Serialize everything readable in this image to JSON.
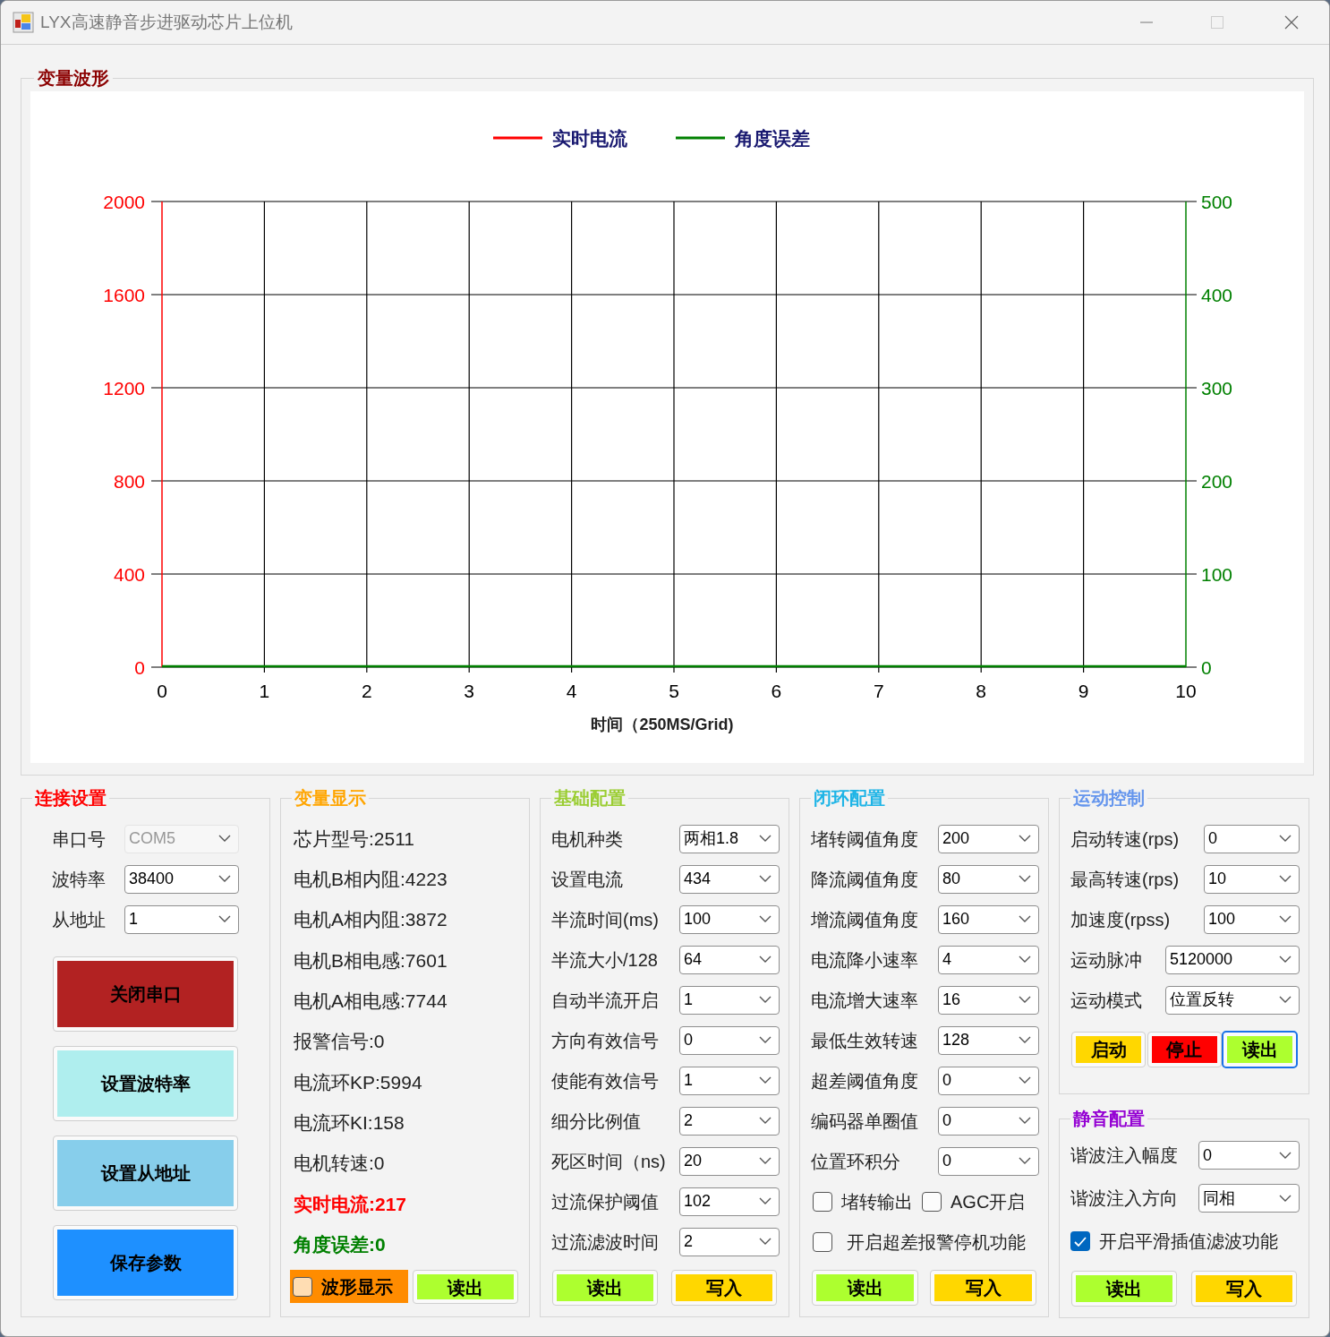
{
  "window": {
    "title": "LYX高速静音步进驱动芯片上位机"
  },
  "waveform": {
    "title": "变量波形",
    "chart_data": {
      "type": "line",
      "xlabel": "时间（250MS/Grid)",
      "grid": true,
      "categories": [
        "0",
        "1",
        "2",
        "3",
        "4",
        "5",
        "6",
        "7",
        "8",
        "9",
        "10"
      ],
      "ylim": [
        0,
        2000
      ],
      "yticks": [
        0,
        400,
        800,
        1200,
        1600,
        2000
      ],
      "y2lim": [
        0,
        500
      ],
      "y2ticks": [
        0,
        100,
        200,
        300,
        400,
        500
      ],
      "series": [
        {
          "name": "实时电流",
          "color": "#ff0000",
          "values": [
            null,
            null,
            null,
            null,
            null,
            null,
            null,
            null,
            null,
            null,
            null
          ]
        },
        {
          "name": "角度误差",
          "color": "#008000",
          "values": [
            0,
            0,
            0,
            0,
            0,
            0,
            0,
            0,
            0,
            0,
            0
          ]
        }
      ]
    }
  },
  "connection": {
    "title": "连接设置",
    "fields": [
      {
        "label": "串口号",
        "value": "COM5",
        "disabled": true
      },
      {
        "label": "波特率",
        "value": "38400",
        "disabled": false
      },
      {
        "label": "从地址",
        "value": "1",
        "disabled": false
      }
    ],
    "buttons": [
      {
        "label": "关闭串口",
        "color": "#b22222"
      },
      {
        "label": "设置波特率",
        "color": "#afeeee"
      },
      {
        "label": "设置从地址",
        "color": "#87ceeb"
      },
      {
        "label": "保存参数",
        "color": "#1e90ff"
      }
    ]
  },
  "variables": {
    "title": "变量显示",
    "items": [
      {
        "text": "芯片型号:2511",
        "kind": "plain"
      },
      {
        "text": "电机B相内阻:4223",
        "kind": "plain"
      },
      {
        "text": "电机A相内阻:3872",
        "kind": "plain"
      },
      {
        "text": "电机B相电感:7601",
        "kind": "plain"
      },
      {
        "text": "电机A相电感:7744",
        "kind": "plain"
      },
      {
        "text": "报警信号:0",
        "kind": "plain"
      },
      {
        "text": "电流环KP:5994",
        "kind": "plain"
      },
      {
        "text": "电流环KI:158",
        "kind": "plain"
      },
      {
        "text": "电机转速:0",
        "kind": "plain"
      },
      {
        "text": "实时电流:217",
        "kind": "current"
      },
      {
        "text": "角度误差:0",
        "kind": "angle"
      }
    ],
    "waveform_toggle": {
      "label": "波形显示",
      "checked": false
    },
    "read_button": "读出"
  },
  "basic": {
    "title": "基础配置",
    "fields": [
      {
        "label": "电机种类",
        "value": "两相1.8"
      },
      {
        "label": "设置电流",
        "value": "434"
      },
      {
        "label": "半流时间(ms)",
        "value": "100"
      },
      {
        "label": "半流大小/128",
        "value": "64"
      },
      {
        "label": "自动半流开启",
        "value": "1"
      },
      {
        "label": "方向有效信号",
        "value": "0"
      },
      {
        "label": "使能有效信号",
        "value": "1"
      },
      {
        "label": "细分比例值",
        "value": "2"
      },
      {
        "label": "死区时间（ns)",
        "value": "20"
      },
      {
        "label": "过流保护阈值",
        "value": "102"
      },
      {
        "label": "过流滤波时间",
        "value": "2"
      }
    ],
    "buttons": [
      {
        "label": "读出",
        "color": "#adff2f"
      },
      {
        "label": "写入",
        "color": "#ffd700"
      }
    ]
  },
  "closed_loop": {
    "title": "闭环配置",
    "fields": [
      {
        "label": "堵转阈值角度",
        "value": "200"
      },
      {
        "label": "降流阈值角度",
        "value": "80"
      },
      {
        "label": "增流阈值角度",
        "value": "160"
      },
      {
        "label": "电流降小速率",
        "value": "4"
      },
      {
        "label": "电流增大速率",
        "value": "16"
      },
      {
        "label": "最低生效转速",
        "value": "128"
      },
      {
        "label": "超差阈值角度",
        "value": "0"
      },
      {
        "label": "编码器单圈值",
        "value": "0"
      },
      {
        "label": "位置环积分",
        "value": "0"
      }
    ],
    "checkboxes": [
      {
        "label": "堵转输出",
        "checked": false
      },
      {
        "label": "AGC开启",
        "checked": false
      },
      {
        "label": "开启超差报警停机功能",
        "checked": false
      }
    ],
    "buttons": [
      {
        "label": "读出",
        "color": "#adff2f"
      },
      {
        "label": "写入",
        "color": "#ffd700"
      }
    ]
  },
  "motion": {
    "title": "运动控制",
    "fields": [
      {
        "label": "启动转速(rps)",
        "value": "0",
        "kind": "narrow"
      },
      {
        "label": "最高转速(rps)",
        "value": "10",
        "kind": "narrow"
      },
      {
        "label": "加速度(rpss)",
        "value": "100",
        "kind": "narrow"
      },
      {
        "label": "运动脉冲",
        "value": "5120000",
        "kind": "wide"
      },
      {
        "label": "运动模式",
        "value": "位置反转",
        "kind": "wide"
      }
    ],
    "buttons": [
      {
        "label": "启动",
        "color": "#ffd700",
        "focused": false
      },
      {
        "label": "停止",
        "color": "#ff0000",
        "focused": false
      },
      {
        "label": "读出",
        "color": "#adff2f",
        "focused": true
      }
    ]
  },
  "silent": {
    "title": "静音配置",
    "fields": [
      {
        "label": "谐波注入幅度",
        "value": "0"
      },
      {
        "label": "谐波注入方向",
        "value": "同相"
      }
    ],
    "checkbox": {
      "label": "开启平滑插值滤波功能",
      "checked": true
    },
    "buttons": [
      {
        "label": "读出",
        "color": "#adff2f"
      },
      {
        "label": "写入",
        "color": "#ffd700"
      }
    ]
  }
}
